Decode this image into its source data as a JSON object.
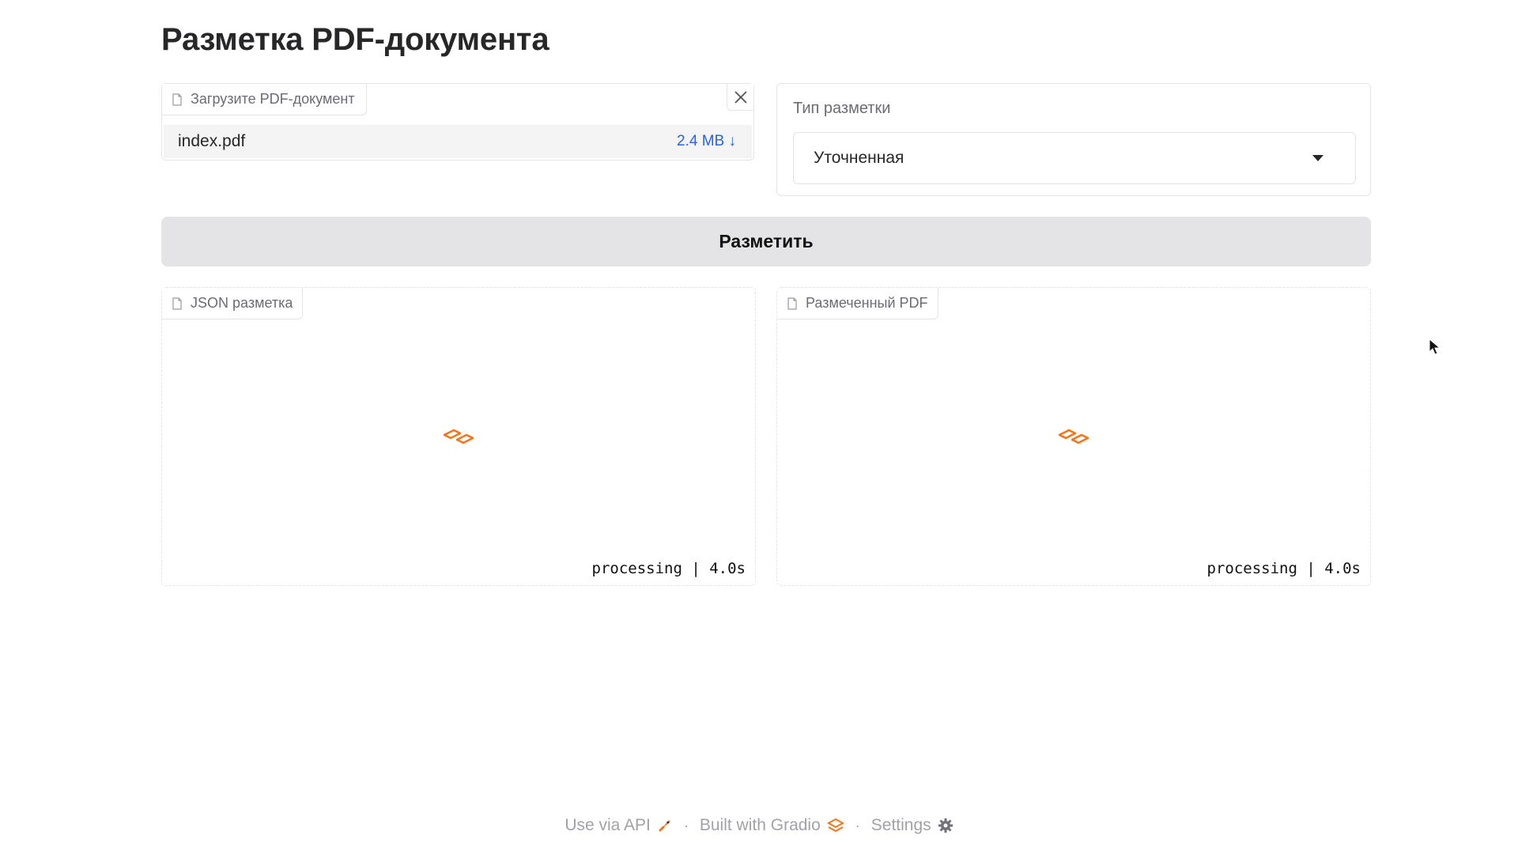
{
  "page": {
    "title": "Разметка PDF-документа"
  },
  "upload": {
    "label": "Загрузите PDF-документ",
    "file_name": "index.pdf",
    "file_size": "2.4 MB ↓"
  },
  "markup_type": {
    "label": "Тип разметки",
    "selected": "Уточненная"
  },
  "actions": {
    "run_label": "Разметить"
  },
  "outputs": {
    "json": {
      "label": "JSON разметка",
      "status": "processing | 4.0s"
    },
    "pdf": {
      "label": "Размеченный PDF",
      "status": "processing | 4.0s"
    }
  },
  "footer": {
    "api": "Use via API",
    "built": "Built with Gradio",
    "settings": "Settings",
    "separator": "·"
  },
  "colors": {
    "accent_orange": "#f97316",
    "link_blue": "#2563eb",
    "button_bg": "#e4e4e7"
  }
}
